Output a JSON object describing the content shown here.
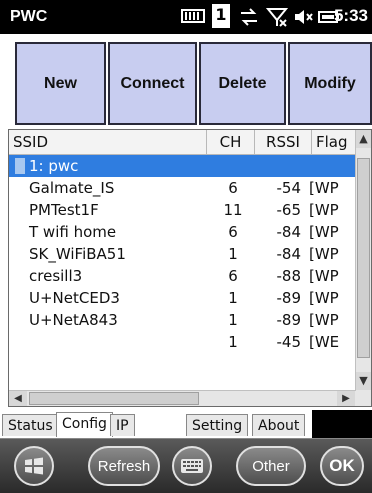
{
  "status_bar": {
    "app_title": "PWC",
    "time": "5:33",
    "notification_count": "1"
  },
  "toolbar": {
    "new_label": "New",
    "connect_label": "Connect",
    "delete_label": "Delete",
    "modify_label": "Modify"
  },
  "table": {
    "columns": [
      "SSID",
      "CH",
      "RSSI",
      "Flags"
    ],
    "flags_header_visible": "Flag",
    "rows": [
      {
        "ssid": "1: pwc",
        "ch": "",
        "rssi": "",
        "flags": ""
      },
      {
        "ssid": "Galmate_IS",
        "ch": "6",
        "rssi": "-54",
        "flags": "[WP"
      },
      {
        "ssid": "PMTest1F",
        "ch": "11",
        "rssi": "-65",
        "flags": "[WP"
      },
      {
        "ssid": "T wifi home",
        "ch": "6",
        "rssi": "-84",
        "flags": "[WP"
      },
      {
        "ssid": "SK_WiFiBA51",
        "ch": "1",
        "rssi": "-84",
        "flags": "[WP"
      },
      {
        "ssid": "cresill3",
        "ch": "6",
        "rssi": "-88",
        "flags": "[WP"
      },
      {
        "ssid": "U+NetCED3",
        "ch": "1",
        "rssi": "-89",
        "flags": "[WP"
      },
      {
        "ssid": "U+NetA843",
        "ch": "1",
        "rssi": "-89",
        "flags": "[WP"
      },
      {
        "ssid": "",
        "ch": "1",
        "rssi": "-45",
        "flags": "[WE"
      }
    ]
  },
  "tabs": [
    "Status",
    "Config",
    "IP",
    "Setting",
    "About"
  ],
  "active_tab": "Config",
  "softkeys": {
    "refresh_label": "Refresh",
    "other_label": "Other",
    "ok_label": "OK"
  },
  "colors": {
    "selection": "#2f7de0",
    "button_bg": "#c8cdf0"
  }
}
